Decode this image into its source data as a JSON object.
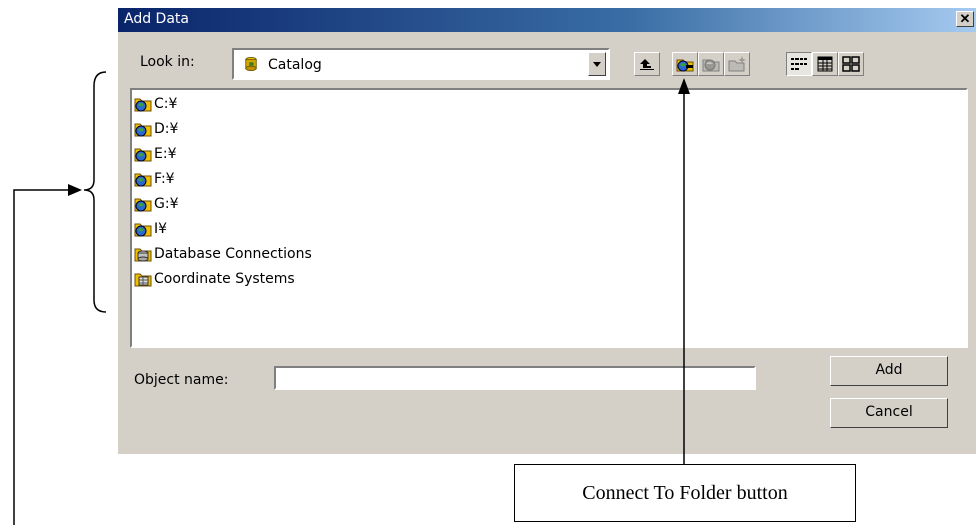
{
  "window": {
    "title": "Add Data",
    "close_glyph": "✕"
  },
  "look_in": {
    "label": "Look in:",
    "value": "Catalog",
    "icon": "catalog-icon"
  },
  "toolbar": {
    "buttons": [
      {
        "name": "up-one-level",
        "icon": "up-arrow-icon"
      },
      {
        "name": "connect-to-folder",
        "icon": "connect-folder-icon"
      },
      {
        "name": "disconnect-from-folder",
        "icon": "disconnect-folder-icon",
        "disabled": true
      },
      {
        "name": "new-folder",
        "icon": "new-folder-icon",
        "disabled": true
      },
      {
        "name": "list-view",
        "icon": "list-view-icon",
        "pressed": true
      },
      {
        "name": "details-view",
        "icon": "details-view-icon"
      },
      {
        "name": "thumbnails-view",
        "icon": "thumbnails-view-icon"
      }
    ]
  },
  "items": [
    {
      "label": "C:¥",
      "icon": "folder-connection-icon"
    },
    {
      "label": "D:¥",
      "icon": "folder-connection-icon"
    },
    {
      "label": "E:¥",
      "icon": "folder-connection-icon"
    },
    {
      "label": "F:¥",
      "icon": "folder-connection-icon"
    },
    {
      "label": "G:¥",
      "icon": "folder-connection-icon"
    },
    {
      "label": "I¥",
      "icon": "folder-connection-icon"
    },
    {
      "label": "Database Connections",
      "icon": "database-connections-icon"
    },
    {
      "label": "Coordinate Systems",
      "icon": "coordinate-systems-icon"
    }
  ],
  "object_name": {
    "label": "Object name:",
    "value": "",
    "placeholder": ""
  },
  "buttons": {
    "add": "Add",
    "cancel": "Cancel"
  },
  "annotation": {
    "callout": "Connect To Folder button"
  },
  "colors": {
    "title_start": "#0a246a",
    "title_end": "#a6caf0",
    "dialog_bg": "#d4d0c8"
  }
}
